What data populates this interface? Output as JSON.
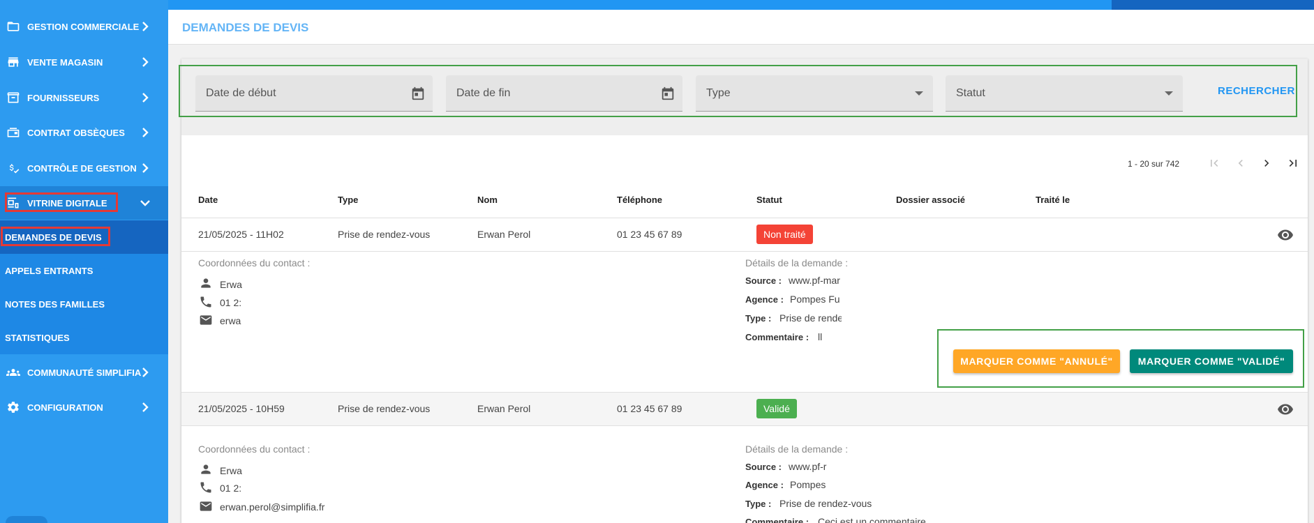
{
  "colors": {
    "sidebar": "#2d9bf0",
    "accent": "#2196f3",
    "danger": "#f44336",
    "success": "#4caf50",
    "warning": "#ffa726",
    "teal": "#00897b"
  },
  "sidebar": {
    "items": [
      {
        "label": "GESTION COMMERCIALE",
        "icon": "folder-icon"
      },
      {
        "label": "VENTE MAGASIN",
        "icon": "store-icon"
      },
      {
        "label": "FOURNISSEURS",
        "icon": "archive-icon"
      },
      {
        "label": "CONTRAT OBSÈQUES",
        "icon": "wallet-icon"
      },
      {
        "label": "CONTRÔLE DE GESTION",
        "icon": "money-check-icon"
      },
      {
        "label": "VITRINE DIGITALE",
        "icon": "digital-storefront-icon"
      },
      {
        "label": "COMMUNAUTÉ SIMPLIFIA",
        "icon": "people-icon"
      },
      {
        "label": "CONFIGURATION",
        "icon": "gear-icon"
      }
    ],
    "subitems": [
      {
        "label": "DEMANDES DE DEVIS"
      },
      {
        "label": "APPELS ENTRANTS"
      },
      {
        "label": "NOTES DES FAMILLES"
      },
      {
        "label": "STATISTIQUES"
      }
    ]
  },
  "header": {
    "title": "DEMANDES DE DEVIS"
  },
  "filters": {
    "start_date": "Date de début",
    "end_date": "Date de fin",
    "type": "Type",
    "status": "Statut",
    "search_label": "RECHERCHER"
  },
  "pagination": {
    "text": "1 - 20 sur 742"
  },
  "table": {
    "columns": [
      "Date",
      "Type",
      "Nom",
      "Téléphone",
      "Statut",
      "Dossier associé",
      "Traité le"
    ],
    "rows": [
      {
        "date": "21/05/2025 - 11H02",
        "type": "Prise de rendez-vous",
        "name": "Erwan Perol",
        "phone": "01 23 45 67 89",
        "status": "Non traité",
        "details": {
          "contact_label": "Coordonnées du contact :",
          "contact_name": "Erwa",
          "contact_phone": "01 2:",
          "contact_email": "erwa",
          "request_label": "Détails de la demande :",
          "source_key": "Source :",
          "source": "www.pf-mar",
          "agency_key": "Agence :",
          "agency": "Pompes Fu",
          "type_key": "Type :",
          "type": "Prise de rende",
          "comment_key": "Commentaire :",
          "comment": "ll"
        },
        "actions": {
          "cancel_label": "MARQUER COMME \"ANNULÉ\"",
          "validate_label": "MARQUER COMME \"VALIDÉ\""
        }
      },
      {
        "date": "21/05/2025 - 10H59",
        "type": "Prise de rendez-vous",
        "name": "Erwan Perol",
        "phone": "01 23 45 67 89",
        "status": "Validé",
        "details": {
          "contact_label": "Coordonnées du contact :",
          "contact_name": "Erwa",
          "contact_phone": "01 2:",
          "contact_email": "erwan.perol@simplifia.fr",
          "request_label": "Détails de la demande :",
          "source_key": "Source :",
          "source": "www.pf-r",
          "agency_key": "Agence :",
          "agency": "Pompes",
          "type_key": "Type :",
          "type": "Prise de rendez-vous",
          "comment_key": "Commentaire :",
          "comment": "Ceci est un commentaire"
        }
      }
    ]
  }
}
